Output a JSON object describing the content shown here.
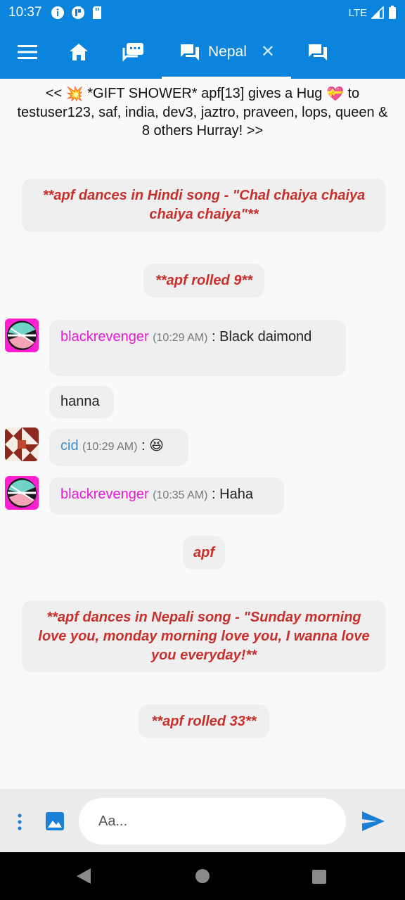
{
  "status_bar": {
    "time": "10:37",
    "network": "LTE"
  },
  "app_bar": {
    "active_tab_label": "Nepal",
    "icons": [
      "menu-icon",
      "home-icon",
      "chat-rooms-icon",
      "chat-icon",
      "close-icon",
      "messages-icon"
    ]
  },
  "chat": {
    "banner": {
      "prefix": "<< ",
      "emoji_burst": "💥",
      "text_a": " *GIFT SHOWER* apf[13] gives a Hug ",
      "emoji_gift": "💝",
      "text_b": " to testuser123, saf, india, dev3, jaztro, praveen, lops, queen & 8 others Hurray! >>"
    },
    "system_messages": [
      "**apf dances in Hindi song - \"Chal chaiya chaiya chaiya chaiya\"**",
      "**apf rolled 9**",
      "apf",
      "**apf dances in Nepali song - \"Sunday morning love you, monday morning love you, I wanna love you everyday!**",
      "**apf rolled 33**"
    ],
    "messages": [
      {
        "user": "blackrevenger",
        "time": "(10:29 AM)",
        "sep": " :  ",
        "text": "Black daimond"
      },
      {
        "text": "hanna"
      },
      {
        "user": "cid",
        "time": "(10:29 AM)",
        "sep": " :  ",
        "text": "😆"
      },
      {
        "user": "blackrevenger",
        "time": "(10:35 AM)",
        "sep": " :  ",
        "text": "Haha"
      }
    ]
  },
  "composer": {
    "placeholder": "Aa..."
  },
  "colors": {
    "primary": "#0b84de",
    "username_pink": "#e31bd1",
    "username_blue": "#3b8fd0",
    "system_text_red": "#c8302c"
  }
}
